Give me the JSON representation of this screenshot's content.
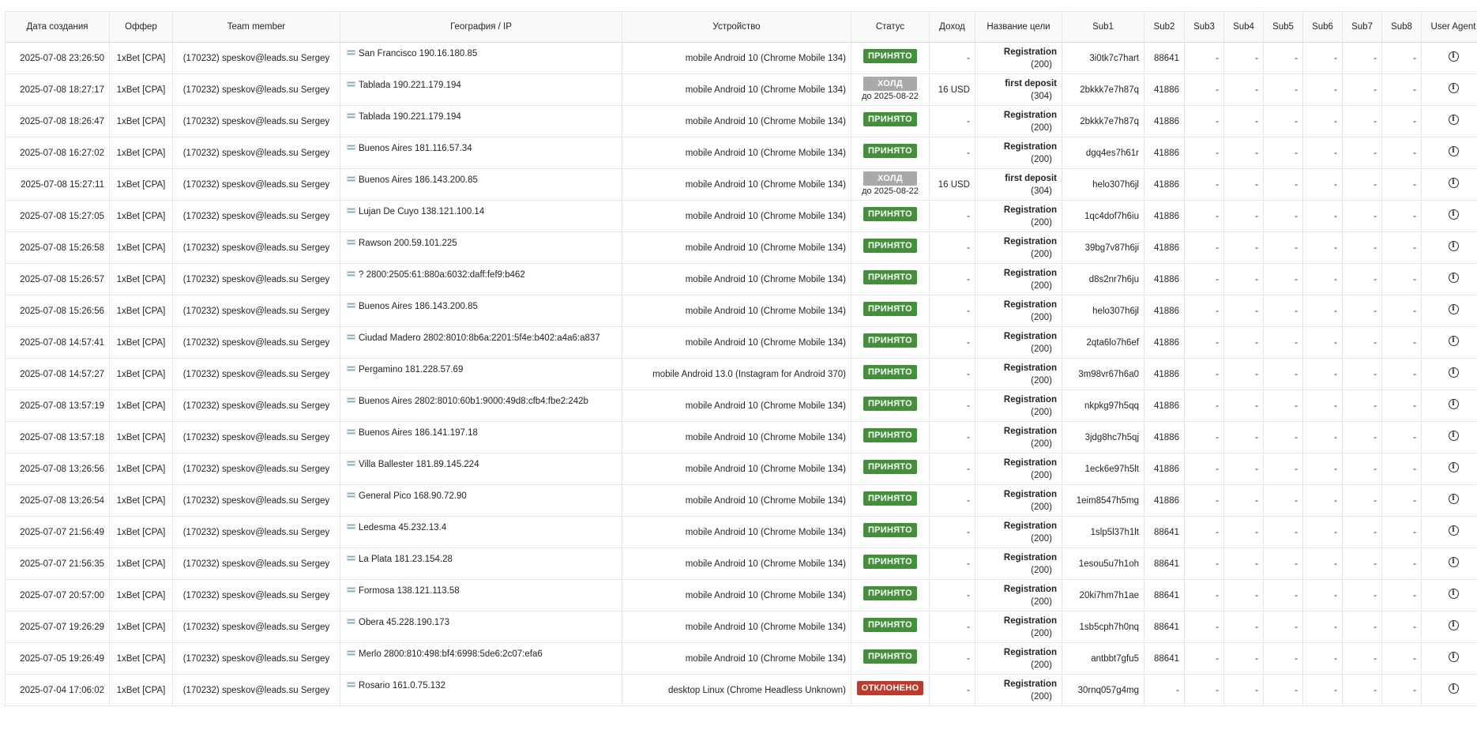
{
  "table": {
    "headers": [
      "Дата создания",
      "Оффер",
      "Team member",
      "География / IP",
      "Устройство",
      "Статус",
      "Доход",
      "Название цели",
      "Sub1",
      "Sub2",
      "Sub3",
      "Sub4",
      "Sub5",
      "Sub6",
      "Sub7",
      "Sub8",
      "User Agent"
    ],
    "rows": [
      {
        "date": "2025-07-08 23:26:50",
        "offer": "1xBet [CPA]",
        "member": "(170232) speskov@leads.su Sergey",
        "geo": "San Francisco 190.16.180.85",
        "device": "mobile Android 10 (Chrome Mobile 134)",
        "status": "ПРИНЯТО",
        "status_type": "accepted",
        "hold_until": "",
        "income": "-",
        "goal": "Registration",
        "goal_code": "(200)",
        "sub1": "3i0tk7c7hart",
        "sub2": "88641",
        "sub3": "-",
        "sub4": "-",
        "sub5": "-",
        "sub6": "-",
        "sub7": "-",
        "sub8": "-"
      },
      {
        "date": "2025-07-08 18:27:17",
        "offer": "1xBet [CPA]",
        "member": "(170232) speskov@leads.su Sergey",
        "geo": "Tablada 190.221.179.194",
        "device": "mobile Android 10 (Chrome Mobile 134)",
        "status": "ХОЛД",
        "status_type": "hold",
        "hold_until": "до 2025-08-22",
        "income": "16 USD",
        "goal": "first deposit",
        "goal_code": "(304)",
        "sub1": "2bkkk7e7h87q",
        "sub2": "41886",
        "sub3": "-",
        "sub4": "-",
        "sub5": "-",
        "sub6": "-",
        "sub7": "-",
        "sub8": "-"
      },
      {
        "date": "2025-07-08 18:26:47",
        "offer": "1xBet [CPA]",
        "member": "(170232) speskov@leads.su Sergey",
        "geo": "Tablada 190.221.179.194",
        "device": "mobile Android 10 (Chrome Mobile 134)",
        "status": "ПРИНЯТО",
        "status_type": "accepted",
        "hold_until": "",
        "income": "-",
        "goal": "Registration",
        "goal_code": "(200)",
        "sub1": "2bkkk7e7h87q",
        "sub2": "41886",
        "sub3": "-",
        "sub4": "-",
        "sub5": "-",
        "sub6": "-",
        "sub7": "-",
        "sub8": "-"
      },
      {
        "date": "2025-07-08 16:27:02",
        "offer": "1xBet [CPA]",
        "member": "(170232) speskov@leads.su Sergey",
        "geo": "Buenos Aires 181.116.57.34",
        "device": "mobile Android 10 (Chrome Mobile 134)",
        "status": "ПРИНЯТО",
        "status_type": "accepted",
        "hold_until": "",
        "income": "-",
        "goal": "Registration",
        "goal_code": "(200)",
        "sub1": "dgq4es7h61r",
        "sub2": "41886",
        "sub3": "-",
        "sub4": "-",
        "sub5": "-",
        "sub6": "-",
        "sub7": "-",
        "sub8": "-"
      },
      {
        "date": "2025-07-08 15:27:11",
        "offer": "1xBet [CPA]",
        "member": "(170232) speskov@leads.su Sergey",
        "geo": "Buenos Aires 186.143.200.85",
        "device": "mobile Android 10 (Chrome Mobile 134)",
        "status": "ХОЛД",
        "status_type": "hold",
        "hold_until": "до 2025-08-22",
        "income": "16 USD",
        "goal": "first deposit",
        "goal_code": "(304)",
        "sub1": "helo307h6jl",
        "sub2": "41886",
        "sub3": "-",
        "sub4": "-",
        "sub5": "-",
        "sub6": "-",
        "sub7": "-",
        "sub8": "-"
      },
      {
        "date": "2025-07-08 15:27:05",
        "offer": "1xBet [CPA]",
        "member": "(170232) speskov@leads.su Sergey",
        "geo": "Lujan De Cuyo 138.121.100.14",
        "device": "mobile Android 10 (Chrome Mobile 134)",
        "status": "ПРИНЯТО",
        "status_type": "accepted",
        "hold_until": "",
        "income": "-",
        "goal": "Registration",
        "goal_code": "(200)",
        "sub1": "1qc4dof7h6iu",
        "sub2": "41886",
        "sub3": "-",
        "sub4": "-",
        "sub5": "-",
        "sub6": "-",
        "sub7": "-",
        "sub8": "-"
      },
      {
        "date": "2025-07-08 15:26:58",
        "offer": "1xBet [CPA]",
        "member": "(170232) speskov@leads.su Sergey",
        "geo": "Rawson 200.59.101.225",
        "device": "mobile Android 10 (Chrome Mobile 134)",
        "status": "ПРИНЯТО",
        "status_type": "accepted",
        "hold_until": "",
        "income": "-",
        "goal": "Registration",
        "goal_code": "(200)",
        "sub1": "39bg7v87h6ji",
        "sub2": "41886",
        "sub3": "-",
        "sub4": "-",
        "sub5": "-",
        "sub6": "-",
        "sub7": "-",
        "sub8": "-"
      },
      {
        "date": "2025-07-08 15:26:57",
        "offer": "1xBet [CPA]",
        "member": "(170232) speskov@leads.su Sergey",
        "geo": "? 2800:2505:61:880a:6032:daff:fef9:b462",
        "device": "mobile Android 10 (Chrome Mobile 134)",
        "status": "ПРИНЯТО",
        "status_type": "accepted",
        "hold_until": "",
        "income": "-",
        "goal": "Registration",
        "goal_code": "(200)",
        "sub1": "d8s2nr7h6ju",
        "sub2": "41886",
        "sub3": "-",
        "sub4": "-",
        "sub5": "-",
        "sub6": "-",
        "sub7": "-",
        "sub8": "-"
      },
      {
        "date": "2025-07-08 15:26:56",
        "offer": "1xBet [CPA]",
        "member": "(170232) speskov@leads.su Sergey",
        "geo": "Buenos Aires 186.143.200.85",
        "device": "mobile Android 10 (Chrome Mobile 134)",
        "status": "ПРИНЯТО",
        "status_type": "accepted",
        "hold_until": "",
        "income": "-",
        "goal": "Registration",
        "goal_code": "(200)",
        "sub1": "helo307h6jl",
        "sub2": "41886",
        "sub3": "-",
        "sub4": "-",
        "sub5": "-",
        "sub6": "-",
        "sub7": "-",
        "sub8": "-"
      },
      {
        "date": "2025-07-08 14:57:41",
        "offer": "1xBet [CPA]",
        "member": "(170232) speskov@leads.su Sergey",
        "geo": "Ciudad Madero 2802:8010:8b6a:2201:5f4e:b402:a4a6:a837",
        "device": "mobile Android 10 (Chrome Mobile 134)",
        "status": "ПРИНЯТО",
        "status_type": "accepted",
        "hold_until": "",
        "income": "-",
        "goal": "Registration",
        "goal_code": "(200)",
        "sub1": "2qta6lo7h6ef",
        "sub2": "41886",
        "sub3": "-",
        "sub4": "-",
        "sub5": "-",
        "sub6": "-",
        "sub7": "-",
        "sub8": "-"
      },
      {
        "date": "2025-07-08 14:57:27",
        "offer": "1xBet [CPA]",
        "member": "(170232) speskov@leads.su Sergey",
        "geo": "Pergamino 181.228.57.69",
        "device": "mobile Android 13.0 (Instagram for Android 370)",
        "status": "ПРИНЯТО",
        "status_type": "accepted",
        "hold_until": "",
        "income": "-",
        "goal": "Registration",
        "goal_code": "(200)",
        "sub1": "3m98vr67h6a0",
        "sub2": "41886",
        "sub3": "-",
        "sub4": "-",
        "sub5": "-",
        "sub6": "-",
        "sub7": "-",
        "sub8": "-"
      },
      {
        "date": "2025-07-08 13:57:19",
        "offer": "1xBet [CPA]",
        "member": "(170232) speskov@leads.su Sergey",
        "geo": "Buenos Aires 2802:8010:60b1:9000:49d8:cfb4:fbe2:242b",
        "device": "mobile Android 10 (Chrome Mobile 134)",
        "status": "ПРИНЯТО",
        "status_type": "accepted",
        "hold_until": "",
        "income": "-",
        "goal": "Registration",
        "goal_code": "(200)",
        "sub1": "nkpkg97h5qq",
        "sub2": "41886",
        "sub3": "-",
        "sub4": "-",
        "sub5": "-",
        "sub6": "-",
        "sub7": "-",
        "sub8": "-"
      },
      {
        "date": "2025-07-08 13:57:18",
        "offer": "1xBet [CPA]",
        "member": "(170232) speskov@leads.su Sergey",
        "geo": "Buenos Aires 186.141.197.18",
        "device": "mobile Android 10 (Chrome Mobile 134)",
        "status": "ПРИНЯТО",
        "status_type": "accepted",
        "hold_until": "",
        "income": "-",
        "goal": "Registration",
        "goal_code": "(200)",
        "sub1": "3jdg8hc7h5qj",
        "sub2": "41886",
        "sub3": "-",
        "sub4": "-",
        "sub5": "-",
        "sub6": "-",
        "sub7": "-",
        "sub8": "-"
      },
      {
        "date": "2025-07-08 13:26:56",
        "offer": "1xBet [CPA]",
        "member": "(170232) speskov@leads.su Sergey",
        "geo": "Villa Ballester 181.89.145.224",
        "device": "mobile Android 10 (Chrome Mobile 134)",
        "status": "ПРИНЯТО",
        "status_type": "accepted",
        "hold_until": "",
        "income": "-",
        "goal": "Registration",
        "goal_code": "(200)",
        "sub1": "1eck6e97h5lt",
        "sub2": "41886",
        "sub3": "-",
        "sub4": "-",
        "sub5": "-",
        "sub6": "-",
        "sub7": "-",
        "sub8": "-"
      },
      {
        "date": "2025-07-08 13:26:54",
        "offer": "1xBet [CPA]",
        "member": "(170232) speskov@leads.su Sergey",
        "geo": "General Pico 168.90.72.90",
        "device": "mobile Android 10 (Chrome Mobile 134)",
        "status": "ПРИНЯТО",
        "status_type": "accepted",
        "hold_until": "",
        "income": "-",
        "goal": "Registration",
        "goal_code": "(200)",
        "sub1": "1eim8547h5mg",
        "sub2": "41886",
        "sub3": "-",
        "sub4": "-",
        "sub5": "-",
        "sub6": "-",
        "sub7": "-",
        "sub8": "-"
      },
      {
        "date": "2025-07-07 21:56:49",
        "offer": "1xBet [CPA]",
        "member": "(170232) speskov@leads.su Sergey",
        "geo": "Ledesma 45.232.13.4",
        "device": "mobile Android 10 (Chrome Mobile 134)",
        "status": "ПРИНЯТО",
        "status_type": "accepted",
        "hold_until": "",
        "income": "-",
        "goal": "Registration",
        "goal_code": "(200)",
        "sub1": "1slp5l37h1lt",
        "sub2": "88641",
        "sub3": "-",
        "sub4": "-",
        "sub5": "-",
        "sub6": "-",
        "sub7": "-",
        "sub8": "-"
      },
      {
        "date": "2025-07-07 21:56:35",
        "offer": "1xBet [CPA]",
        "member": "(170232) speskov@leads.su Sergey",
        "geo": "La Plata 181.23.154.28",
        "device": "mobile Android 10 (Chrome Mobile 134)",
        "status": "ПРИНЯТО",
        "status_type": "accepted",
        "hold_until": "",
        "income": "-",
        "goal": "Registration",
        "goal_code": "(200)",
        "sub1": "1esou5u7h1oh",
        "sub2": "88641",
        "sub3": "-",
        "sub4": "-",
        "sub5": "-",
        "sub6": "-",
        "sub7": "-",
        "sub8": "-"
      },
      {
        "date": "2025-07-07 20:57:00",
        "offer": "1xBet [CPA]",
        "member": "(170232) speskov@leads.su Sergey",
        "geo": "Formosa 138.121.113.58",
        "device": "mobile Android 10 (Chrome Mobile 134)",
        "status": "ПРИНЯТО",
        "status_type": "accepted",
        "hold_until": "",
        "income": "-",
        "goal": "Registration",
        "goal_code": "(200)",
        "sub1": "20ki7hm7h1ae",
        "sub2": "88641",
        "sub3": "-",
        "sub4": "-",
        "sub5": "-",
        "sub6": "-",
        "sub7": "-",
        "sub8": "-"
      },
      {
        "date": "2025-07-07 19:26:29",
        "offer": "1xBet [CPA]",
        "member": "(170232) speskov@leads.su Sergey",
        "geo": "Obera 45.228.190.173",
        "device": "mobile Android 10 (Chrome Mobile 134)",
        "status": "ПРИНЯТО",
        "status_type": "accepted",
        "hold_until": "",
        "income": "-",
        "goal": "Registration",
        "goal_code": "(200)",
        "sub1": "1sb5cph7h0nq",
        "sub2": "88641",
        "sub3": "-",
        "sub4": "-",
        "sub5": "-",
        "sub6": "-",
        "sub7": "-",
        "sub8": "-"
      },
      {
        "date": "2025-07-05 19:26:49",
        "offer": "1xBet [CPA]",
        "member": "(170232) speskov@leads.su Sergey",
        "geo": "Merlo 2800:810:498:bf4:6998:5de6:2c07:efa6",
        "device": "mobile Android 10 (Chrome Mobile 134)",
        "status": "ПРИНЯТО",
        "status_type": "accepted",
        "hold_until": "",
        "income": "-",
        "goal": "Registration",
        "goal_code": "(200)",
        "sub1": "antbbt7gfu5",
        "sub2": "88641",
        "sub3": "-",
        "sub4": "-",
        "sub5": "-",
        "sub6": "-",
        "sub7": "-",
        "sub8": "-"
      },
      {
        "date": "2025-07-04 17:06:02",
        "offer": "1xBet [CPA]",
        "member": "(170232) speskov@leads.su Sergey",
        "geo": "Rosario 161.0.75.132",
        "device": "desktop Linux (Chrome Headless Unknown)",
        "status": "ОТКЛОНЕНО",
        "status_type": "rejected",
        "hold_until": "",
        "income": "-",
        "goal": "Registration",
        "goal_code": "(200)",
        "sub1": "30rnq057g4mg",
        "sub2": "-",
        "sub3": "-",
        "sub4": "-",
        "sub5": "-",
        "sub6": "-",
        "sub7": "-",
        "sub8": "-"
      }
    ]
  },
  "icons": {
    "flag": "argentina-flag-icon",
    "user_agent": "info-icon"
  },
  "colors": {
    "accepted": "#43903a",
    "hold": "#a9a9a9",
    "rejected": "#c0392b"
  }
}
